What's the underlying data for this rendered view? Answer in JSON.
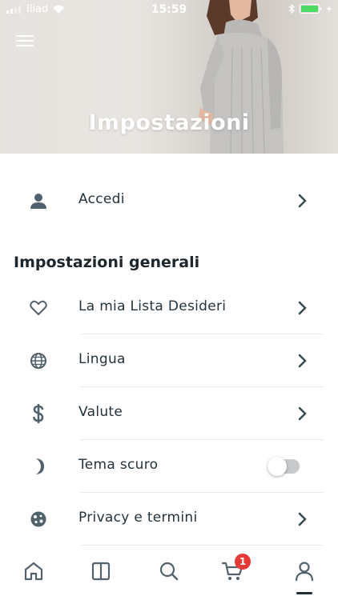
{
  "status_bar": {
    "carrier": "Iliad",
    "time": "15:59"
  },
  "header": {
    "title": "Impostazioni",
    "menu_icon": "hamburger-icon"
  },
  "account": {
    "login_label": "Accedi",
    "icon": "user-icon"
  },
  "general": {
    "section_title": "Impostazioni generali",
    "items": [
      {
        "label": "La mia Lista Desideri",
        "icon": "heart-icon"
      },
      {
        "label": "Lingua",
        "icon": "globe-icon"
      },
      {
        "label": "Valute",
        "icon": "dollar-icon"
      },
      {
        "label": "Tema scuro",
        "icon": "moon-icon",
        "toggle": false
      },
      {
        "label": "Privacy e termini",
        "icon": "cookie-icon"
      }
    ]
  },
  "tab_bar": {
    "tabs": [
      "home-icon",
      "catalog-icon",
      "search-icon",
      "cart-icon",
      "profile-icon"
    ],
    "cart_badge": "1",
    "active_tab": "profile"
  },
  "colors": {
    "icon": "#52626c",
    "text": "#24323b",
    "badge": "#e53935",
    "battery": "#4cd964"
  }
}
